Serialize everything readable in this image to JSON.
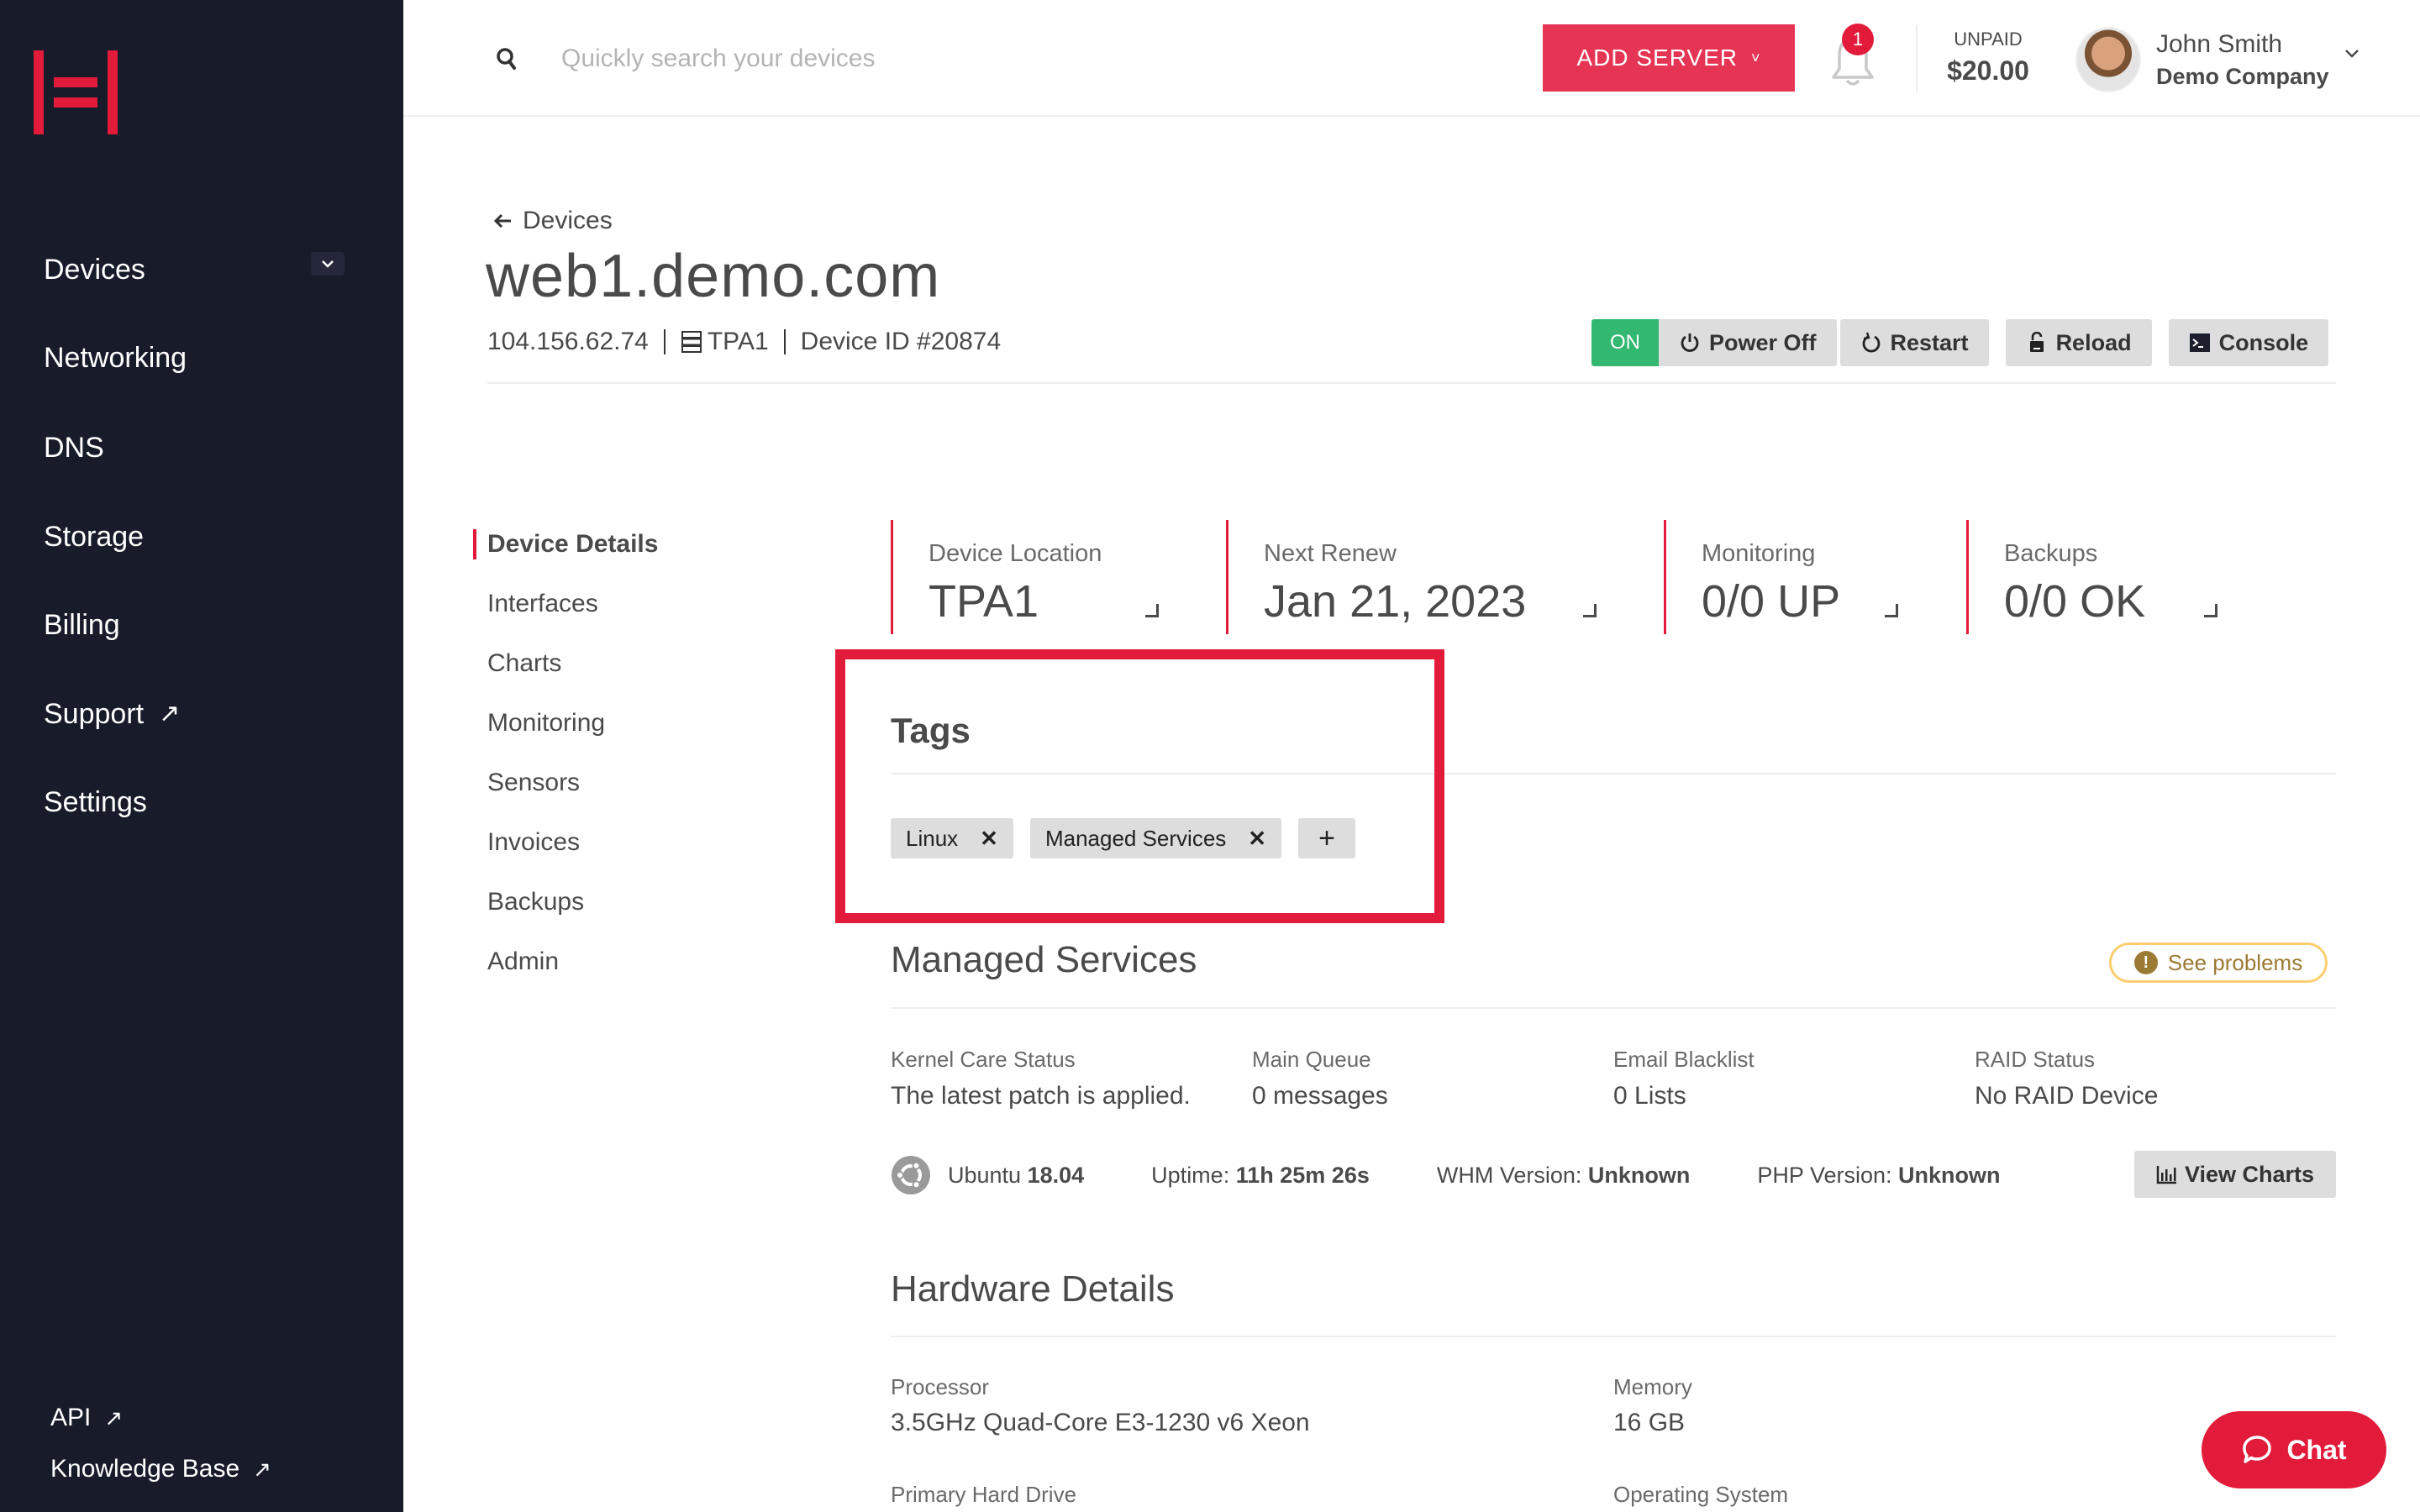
{
  "app": {
    "brand_color": "#e31b3b",
    "sidebar_bg": "#181b29"
  },
  "sidebar": {
    "logo": "hivelocity-logo",
    "items": [
      {
        "label": "Devices",
        "expandable": true
      },
      {
        "label": "Networking"
      },
      {
        "label": "DNS"
      },
      {
        "label": "Storage"
      },
      {
        "label": "Billing"
      },
      {
        "label": "Support",
        "external": true
      },
      {
        "label": "Settings"
      }
    ],
    "footer_links": [
      {
        "label": "API",
        "external": true
      },
      {
        "label": "Knowledge Base",
        "external": true
      }
    ],
    "external_icon": "↗"
  },
  "header": {
    "search": {
      "placeholder": "Quickly search your devices",
      "value": ""
    },
    "add_server_label": "ADD SERVER",
    "notifications_count": "1",
    "unpaid_label": "UNPAID",
    "unpaid_amount": "$20.00",
    "user": {
      "name": "John Smith",
      "company": "Demo Company"
    }
  },
  "device": {
    "back_label": "Devices",
    "title": "web1.demo.com",
    "ip": "104.156.62.74",
    "location": "TPA1",
    "device_id": "Device ID #20874",
    "power_state": "ON",
    "state_color": "#33b871",
    "actions": [
      {
        "label": "Power Off",
        "icon": "power-icon"
      },
      {
        "label": "Restart",
        "icon": "restart-icon"
      },
      {
        "label": "Reload",
        "icon": "reload-icon"
      },
      {
        "label": "Console",
        "icon": "console-icon"
      }
    ]
  },
  "subnav": {
    "active": "Device Details",
    "items": [
      "Device Details",
      "Interfaces",
      "Charts",
      "Monitoring",
      "Sensors",
      "Invoices",
      "Backups",
      "Admin"
    ]
  },
  "stats": [
    {
      "label": "Device Location",
      "value": "TPA1"
    },
    {
      "label": "Next Renew",
      "value": "Jan 21, 2023"
    },
    {
      "label": "Monitoring",
      "value": "0/0 UP"
    },
    {
      "label": "Backups",
      "value": "0/0 OK"
    }
  ],
  "tags": {
    "title": "Tags",
    "items": [
      "Linux",
      "Managed Services"
    ],
    "remove_icon": "✕",
    "add_icon": "+"
  },
  "managed_services": {
    "title": "Managed Services",
    "see_problems_label": "See problems",
    "fields": [
      {
        "label": "Kernel Care Status",
        "value": "The latest patch is applied."
      },
      {
        "label": "Main Queue",
        "value": "0 messages"
      },
      {
        "label": "Email Blacklist",
        "value": "0 Lists"
      },
      {
        "label": "RAID Status",
        "value": "No RAID Device"
      }
    ],
    "os_name": "Ubuntu",
    "os_version": "18.04",
    "uptime_label": "Uptime:",
    "uptime_value": "11h 25m 26s",
    "whm_label": "WHM Version:",
    "whm_value": "Unknown",
    "php_label": "PHP Version:",
    "php_value": "Unknown",
    "view_charts_label": "View Charts"
  },
  "hardware": {
    "title": "Hardware Details",
    "fields": [
      {
        "label": "Processor",
        "value": "3.5GHz Quad-Core E3-1230 v6 Xeon"
      },
      {
        "label": "Memory",
        "value": "16 GB"
      },
      {
        "label": "Primary Hard Drive",
        "value": ""
      },
      {
        "label": "Operating System",
        "value": ""
      }
    ]
  },
  "chat": {
    "label": "Chat"
  }
}
